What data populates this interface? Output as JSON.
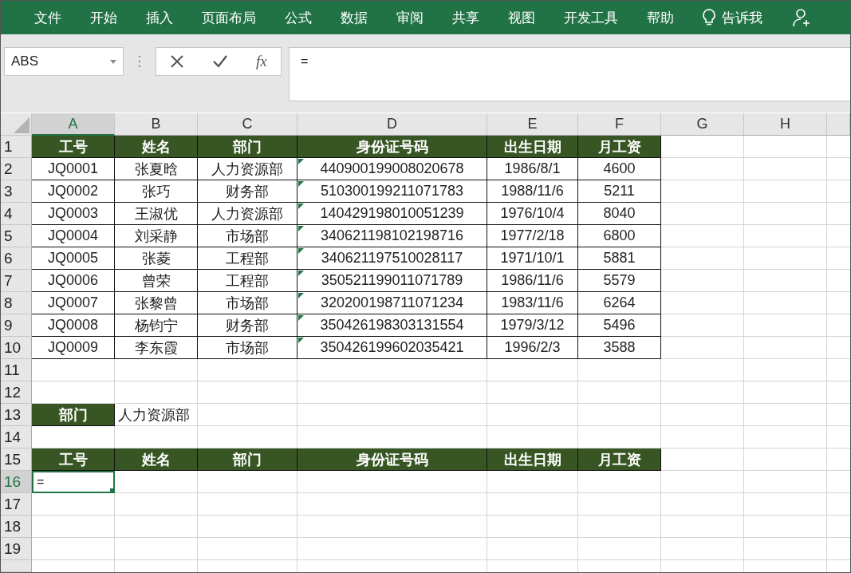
{
  "ribbon": {
    "tabs": [
      {
        "label": "文件"
      },
      {
        "label": "开始"
      },
      {
        "label": "插入"
      },
      {
        "label": "页面布局"
      },
      {
        "label": "公式"
      },
      {
        "label": "数据"
      },
      {
        "label": "审阅"
      },
      {
        "label": "共享"
      },
      {
        "label": "视图"
      },
      {
        "label": "开发工具"
      },
      {
        "label": "帮助"
      }
    ],
    "tell_me": "告诉我"
  },
  "formula_bar": {
    "name_box": "ABS",
    "function_label": "fx",
    "formula": "="
  },
  "columns": [
    {
      "label": "A",
      "selected": true
    },
    {
      "label": "B",
      "selected": false
    },
    {
      "label": "C",
      "selected": false
    },
    {
      "label": "D",
      "selected": false
    },
    {
      "label": "E",
      "selected": false
    },
    {
      "label": "F",
      "selected": false
    },
    {
      "label": "G",
      "selected": false
    },
    {
      "label": "H",
      "selected": false
    }
  ],
  "rows": [
    {
      "number": "1",
      "selected": false,
      "cells": [
        {
          "kind": "header",
          "text": "工号"
        },
        {
          "kind": "header",
          "text": "姓名"
        },
        {
          "kind": "header",
          "text": "部门"
        },
        {
          "kind": "header",
          "text": "身份证号码"
        },
        {
          "kind": "header",
          "text": "出生日期"
        },
        {
          "kind": "header",
          "text": "月工资"
        }
      ]
    },
    {
      "number": "2",
      "selected": false,
      "cells": [
        {
          "kind": "data",
          "text": "JQ0001"
        },
        {
          "kind": "data",
          "text": "张夏晗"
        },
        {
          "kind": "data",
          "text": "人力资源部"
        },
        {
          "kind": "flagged",
          "text": "440900199008020678"
        },
        {
          "kind": "data",
          "text": "1986/8/1"
        },
        {
          "kind": "data",
          "text": "4600"
        }
      ]
    },
    {
      "number": "3",
      "selected": false,
      "cells": [
        {
          "kind": "data",
          "text": "JQ0002"
        },
        {
          "kind": "data",
          "text": "张巧"
        },
        {
          "kind": "data",
          "text": "财务部"
        },
        {
          "kind": "flagged",
          "text": "510300199211071783"
        },
        {
          "kind": "data",
          "text": "1988/11/6"
        },
        {
          "kind": "data",
          "text": "5211"
        }
      ]
    },
    {
      "number": "4",
      "selected": false,
      "cells": [
        {
          "kind": "data",
          "text": "JQ0003"
        },
        {
          "kind": "data",
          "text": "王淑优"
        },
        {
          "kind": "data",
          "text": "人力资源部"
        },
        {
          "kind": "flagged",
          "text": "140429198010051239"
        },
        {
          "kind": "data",
          "text": "1976/10/4"
        },
        {
          "kind": "data",
          "text": "8040"
        }
      ]
    },
    {
      "number": "5",
      "selected": false,
      "cells": [
        {
          "kind": "data",
          "text": "JQ0004"
        },
        {
          "kind": "data",
          "text": "刘采静"
        },
        {
          "kind": "data",
          "text": "市场部"
        },
        {
          "kind": "flagged",
          "text": "340621198102198716"
        },
        {
          "kind": "data",
          "text": "1977/2/18"
        },
        {
          "kind": "data",
          "text": "6800"
        }
      ]
    },
    {
      "number": "6",
      "selected": false,
      "cells": [
        {
          "kind": "data",
          "text": "JQ0005"
        },
        {
          "kind": "data",
          "text": "张菱"
        },
        {
          "kind": "data",
          "text": "工程部"
        },
        {
          "kind": "flagged",
          "text": "340621197510028117"
        },
        {
          "kind": "data",
          "text": "1971/10/1"
        },
        {
          "kind": "data",
          "text": "5881"
        }
      ]
    },
    {
      "number": "7",
      "selected": false,
      "cells": [
        {
          "kind": "data",
          "text": "JQ0006"
        },
        {
          "kind": "data",
          "text": "曾荣"
        },
        {
          "kind": "data",
          "text": "工程部"
        },
        {
          "kind": "flagged",
          "text": "350521199011071789"
        },
        {
          "kind": "data",
          "text": "1986/11/6"
        },
        {
          "kind": "data",
          "text": "5579"
        }
      ]
    },
    {
      "number": "8",
      "selected": false,
      "cells": [
        {
          "kind": "data",
          "text": "JQ0007"
        },
        {
          "kind": "data",
          "text": "张黎曾"
        },
        {
          "kind": "data",
          "text": "市场部"
        },
        {
          "kind": "flagged",
          "text": "320200198711071234"
        },
        {
          "kind": "data",
          "text": "1983/11/6"
        },
        {
          "kind": "data",
          "text": "6264"
        }
      ]
    },
    {
      "number": "9",
      "selected": false,
      "cells": [
        {
          "kind": "data",
          "text": "JQ0008"
        },
        {
          "kind": "data",
          "text": "杨钧宁"
        },
        {
          "kind": "data",
          "text": "财务部"
        },
        {
          "kind": "flagged",
          "text": "350426198303131554"
        },
        {
          "kind": "data",
          "text": "1979/3/12"
        },
        {
          "kind": "data",
          "text": "5496"
        }
      ]
    },
    {
      "number": "10",
      "selected": false,
      "cells": [
        {
          "kind": "data",
          "text": "JQ0009"
        },
        {
          "kind": "data",
          "text": "李东霞"
        },
        {
          "kind": "data",
          "text": "市场部"
        },
        {
          "kind": "flagged",
          "text": "350426199602035421"
        },
        {
          "kind": "data",
          "text": "1996/2/3"
        },
        {
          "kind": "data",
          "text": "3588"
        }
      ]
    },
    {
      "number": "11",
      "selected": false
    },
    {
      "number": "12",
      "selected": false
    },
    {
      "number": "13",
      "selected": false,
      "cells": [
        {
          "kind": "header",
          "text": "部门"
        },
        {
          "kind": "label",
          "text": "人力资源部"
        }
      ]
    },
    {
      "number": "14",
      "selected": false
    },
    {
      "number": "15",
      "selected": false,
      "cells": [
        {
          "kind": "header",
          "text": "工号"
        },
        {
          "kind": "header",
          "text": "姓名"
        },
        {
          "kind": "header",
          "text": "部门"
        },
        {
          "kind": "header",
          "text": "身份证号码"
        },
        {
          "kind": "header",
          "text": "出生日期"
        },
        {
          "kind": "header",
          "text": "月工资"
        }
      ]
    },
    {
      "number": "16",
      "selected": true,
      "cells": [
        {
          "kind": "editing",
          "text": "="
        }
      ]
    },
    {
      "number": "17",
      "selected": false
    },
    {
      "number": "18",
      "selected": false
    },
    {
      "number": "19",
      "selected": false
    }
  ]
}
